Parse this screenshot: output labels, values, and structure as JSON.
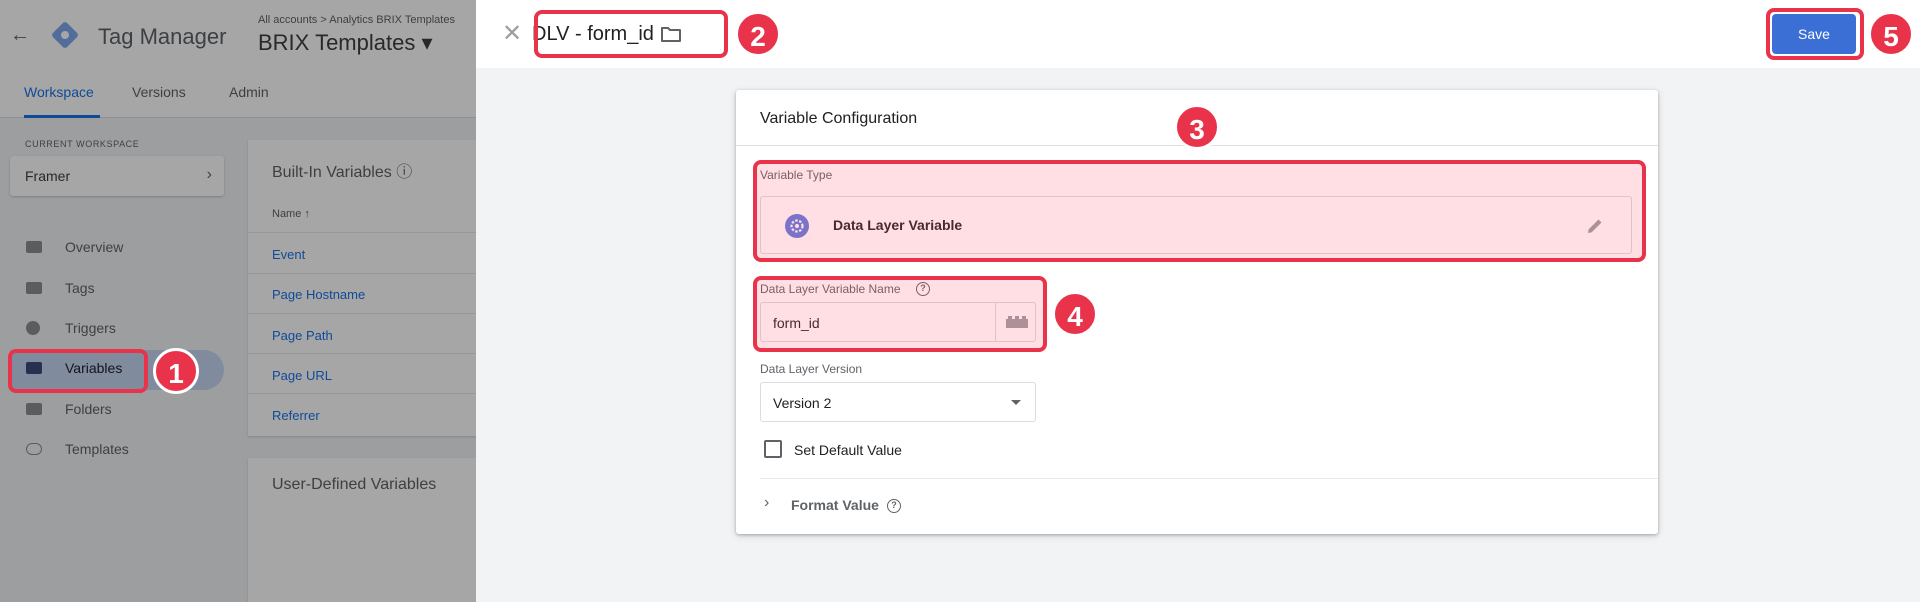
{
  "background_app": {
    "product": "Tag Manager",
    "breadcrumb": "All accounts > Analytics BRIX Templates",
    "container": "BRIX Templates",
    "tabs": [
      "Workspace",
      "Versions",
      "Admin"
    ],
    "current_workspace_label": "CURRENT WORKSPACE",
    "workspace_name": "Framer",
    "nav": [
      "Overview",
      "Tags",
      "Triggers",
      "Variables",
      "Folders",
      "Templates"
    ],
    "builtin_title": "Built-In Variables",
    "name_column": "Name",
    "builtin_vars": [
      "Event",
      "Page Hostname",
      "Page Path",
      "Page URL",
      "Referrer"
    ],
    "user_defined_title": "User-Defined Variables"
  },
  "sheet": {
    "title": "DLV - form_id",
    "save_label": "Save"
  },
  "config": {
    "title": "Variable Configuration",
    "variable_type_label": "Variable Type",
    "variable_type": "Data Layer Variable",
    "dlv_name_label": "Data Layer Variable Name",
    "dlv_name_value": "form_id",
    "version_label": "Data Layer Version",
    "version_value": "Version 2",
    "set_default_label": "Set Default Value",
    "format_value_label": "Format Value"
  },
  "annotations": [
    "1",
    "2",
    "3",
    "4",
    "5"
  ],
  "colors": {
    "accent": "#e8334a",
    "save_button": "#3b6fd6",
    "gear_badge": "#5e7ce0"
  }
}
